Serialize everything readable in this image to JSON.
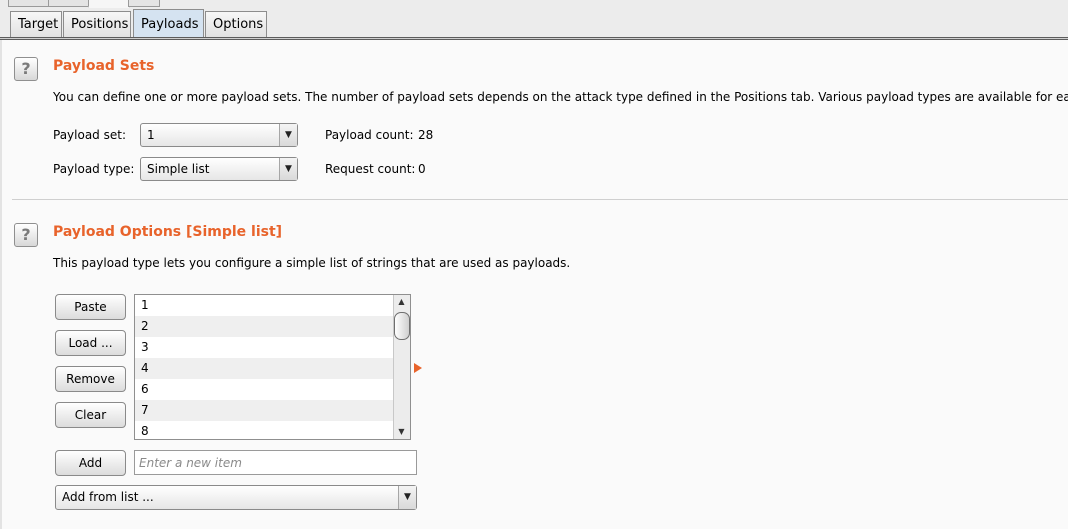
{
  "tabs": [
    {
      "label": "Target"
    },
    {
      "label": "Positions"
    },
    {
      "label": "Payloads"
    },
    {
      "label": "Options"
    }
  ],
  "payload_sets": {
    "help": "?",
    "title": "Payload Sets",
    "description": "You can define one or more payload sets. The number of payload sets depends on the attack type defined in the Positions tab. Various payload types are available for each pay",
    "payload_set_label": "Payload set:",
    "payload_set_value": "1",
    "payload_type_label": "Payload type:",
    "payload_type_value": "Simple list",
    "payload_count_label": "Payload count:",
    "payload_count_value": "28",
    "request_count_label": "Request count:",
    "request_count_value": "0"
  },
  "payload_options": {
    "help": "?",
    "title": "Payload Options [Simple list]",
    "description": "This payload type lets you configure a simple list of strings that are used as payloads.",
    "buttons": {
      "paste": "Paste",
      "load": "Load ...",
      "remove": "Remove",
      "clear": "Clear",
      "add": "Add"
    },
    "list_items": [
      "1",
      "2",
      "3",
      "4",
      "6",
      "7",
      "8"
    ],
    "new_item_placeholder": "Enter a new item",
    "add_from_list": "Add from list ..."
  },
  "colors": {
    "accent": "#e8632b",
    "active_tab": "#d5e3f1"
  }
}
